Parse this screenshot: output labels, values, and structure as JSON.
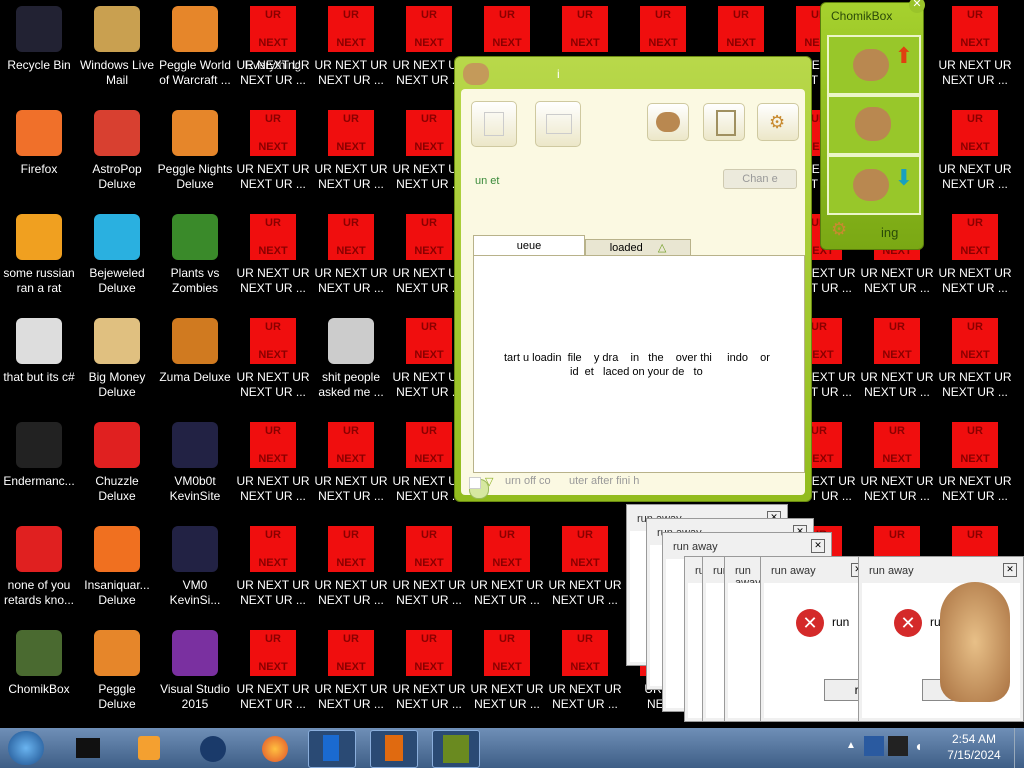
{
  "desktop": {
    "icons": [
      {
        "label": "Recycle Bin",
        "icon": "recycle-bin-icon"
      },
      {
        "label": "Windows Live\nMail",
        "icon": "mail-icon"
      },
      {
        "label": "Peggle World\nof Warcraft ...",
        "icon": "peggle-icon"
      },
      {
        "label": "Everything",
        "icon": "everything-icon"
      },
      {
        "label": "Firefox",
        "icon": "firefox-icon"
      },
      {
        "label": "AstroPop\nDeluxe",
        "icon": "astropop-icon"
      },
      {
        "label": "Peggle Nights\nDeluxe",
        "icon": "peggle-nights-icon"
      },
      {
        "label": "some russian\nran a rat",
        "icon": "file-icon"
      },
      {
        "label": "Bejeweled\nDeluxe",
        "icon": "bejeweled-icon"
      },
      {
        "label": "Plants vs\nZombies",
        "icon": "pvz-icon"
      },
      {
        "label": "that but its c#",
        "icon": "file-icon"
      },
      {
        "label": "Big Money\nDeluxe",
        "icon": "bigmoney-icon"
      },
      {
        "label": "Zuma Deluxe",
        "icon": "zuma-icon"
      },
      {
        "label": "shit people\nasked me ...",
        "icon": "folder-icon"
      },
      {
        "label": "Endermanc...",
        "icon": "file-icon"
      },
      {
        "label": "Chuzzle\nDeluxe",
        "icon": "chuzzle-icon"
      },
      {
        "label": "VM0b0t\nKevinSite",
        "icon": "vm-icon"
      },
      {
        "label": "none of you\nretards kno...",
        "icon": "file-icon"
      },
      {
        "label": "Insaniquar...\nDeluxe",
        "icon": "fish-icon"
      },
      {
        "label": "VM0\nKevinSi...",
        "icon": "vm-icon"
      },
      {
        "label": "ChomikBox",
        "icon": "chomikbox-icon"
      },
      {
        "label": "Peggle Deluxe",
        "icon": "peggle-icon"
      },
      {
        "label": "Visual Studio\n2015",
        "icon": "visual-studio-icon"
      }
    ],
    "ur_top": "UR",
    "ur_bottom": "NEXT",
    "ur_label": "UR NEXT UR\nNEXT UR ...",
    "ur_label_cut": "UR NE\nNEXT"
  },
  "chomikbox": {
    "title": "i",
    "status": "un et",
    "change_button": "Chan e",
    "tab_queue": "ueue",
    "tab_loaded": "loaded",
    "drop_hint_1": "tart u loadin  file    y dra    in   the    over thi     indo    or",
    "drop_hint_2": "id  et   laced on your de   to",
    "shutdown_label": "urn off co      uter after fini h"
  },
  "widget": {
    "title": "ChomikBox",
    "status": "ing"
  },
  "dialog": {
    "title": "run away",
    "message": "run",
    "button": "ru"
  },
  "taskbar": {
    "time": "2:54 AM",
    "date": "7/15/2024"
  },
  "colors": {
    "accent": "#9cc428",
    "ur_red": "#f00e0e"
  }
}
